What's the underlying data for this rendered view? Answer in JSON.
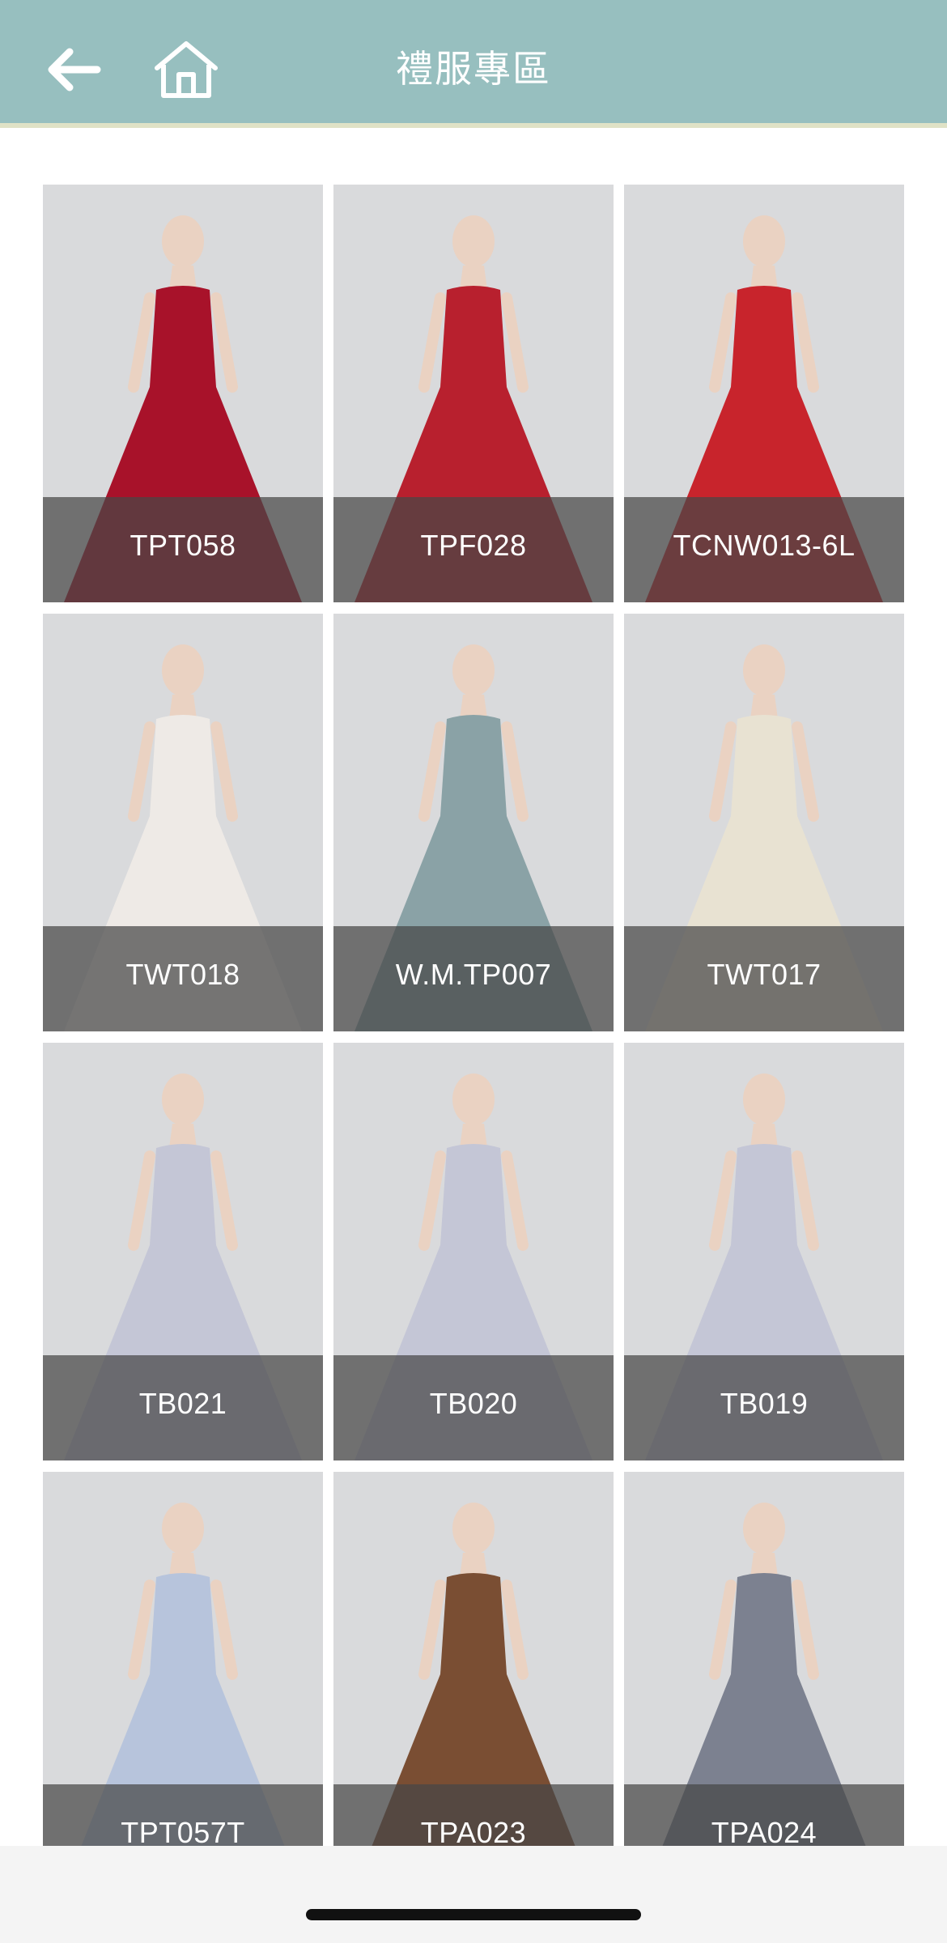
{
  "header": {
    "title": "禮服專區",
    "back_icon": "back-arrow-icon",
    "home_icon": "home-icon",
    "bar_color": "#97bfbf"
  },
  "gallery": {
    "items": [
      {
        "code": "TPT058",
        "dress_color": "#a8122a"
      },
      {
        "code": "TPF028",
        "dress_color": "#b8202e"
      },
      {
        "code": "TCNW013-6L",
        "dress_color": "#c8242c"
      },
      {
        "code": "TWT018",
        "dress_color": "#eeeae6"
      },
      {
        "code": "W.M.TP007",
        "dress_color": "#8aa2a6"
      },
      {
        "code": "TWT017",
        "dress_color": "#e8e2d2"
      },
      {
        "code": "TB021",
        "dress_color": "#c4c6d6"
      },
      {
        "code": "TB020",
        "dress_color": "#c4c6d6"
      },
      {
        "code": "TB019",
        "dress_color": "#c4c6d6"
      },
      {
        "code": "TPT057T",
        "dress_color": "#b7c4dc"
      },
      {
        "code": "TPA023",
        "dress_color": "#7a4e33"
      },
      {
        "code": "TPA024",
        "dress_color": "#7c8190"
      }
    ]
  }
}
